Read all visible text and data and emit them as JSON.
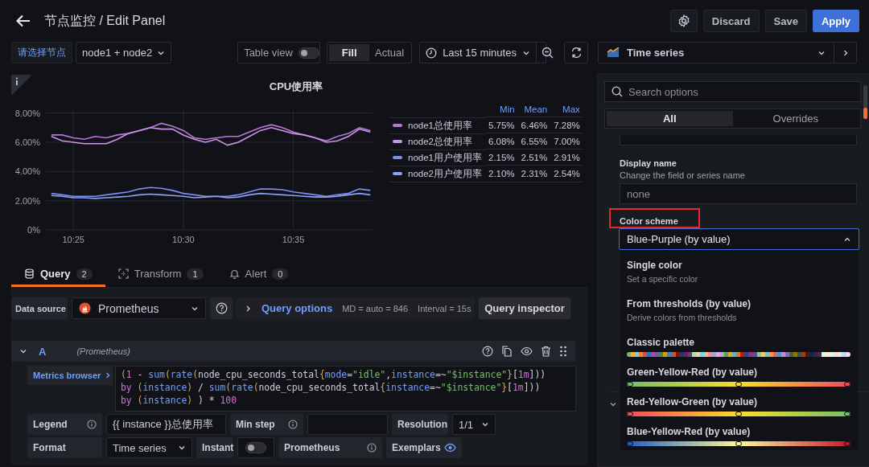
{
  "header": {
    "title": "节点监控 / Edit Panel",
    "buttons": [
      {
        "label": "Discard",
        "kind": "secondary"
      },
      {
        "label": "Save",
        "kind": "secondary"
      },
      {
        "label": "Apply",
        "kind": "primary"
      }
    ]
  },
  "toolbar": {
    "variable_label": "请选择节点",
    "variable_value": "node1 + node2",
    "table_view": {
      "label": "Table view",
      "on": false
    },
    "display_modes": [
      {
        "label": "Fill",
        "selected": true
      },
      {
        "label": "Actual",
        "selected": false
      }
    ],
    "time_range": "Last 15 minutes"
  },
  "visualization": {
    "label": "Time series"
  },
  "panel": {
    "chart_data": {
      "type": "line",
      "title": "CPU使用率",
      "grid": true,
      "categories": [
        null,
        null,
        "10:25",
        null,
        null,
        null,
        null,
        null,
        null,
        null,
        null,
        null,
        "10:30",
        null,
        null,
        null,
        null,
        null,
        null,
        null,
        null,
        null,
        "10:35",
        null,
        null,
        null,
        null,
        null,
        null,
        null
      ],
      "ylim": [
        0,
        8.2
      ],
      "yticks": [
        {
          "value": 0,
          "label": "0%"
        },
        {
          "value": 2,
          "label": "2.00%"
        },
        {
          "value": 4,
          "label": "4.00%"
        },
        {
          "value": 6,
          "label": "6.00%"
        },
        {
          "value": 8,
          "label": "8.00%"
        }
      ],
      "series": [
        {
          "name": "node1总使用率",
          "color": "#b877d9",
          "values": [
            6.5,
            6.5,
            6.3,
            6.2,
            6.4,
            6.3,
            6.5,
            6.6,
            6.8,
            7.0,
            7.3,
            7.1,
            6.8,
            6.3,
            6.2,
            6.3,
            6.4,
            6.4,
            6.7,
            7.0,
            7.2,
            7.0,
            6.7,
            6.5,
            6.3,
            6.1,
            6.4,
            6.6,
            7.0,
            6.8
          ]
        },
        {
          "name": "node2总使用率",
          "color": "#ca95e5",
          "values": [
            6.4,
            6.1,
            6.0,
            5.9,
            5.9,
            5.9,
            6.2,
            6.6,
            6.8,
            7.0,
            6.9,
            6.9,
            6.5,
            6.2,
            6.0,
            6.2,
            5.8,
            6.0,
            6.4,
            6.8,
            7.0,
            6.8,
            6.6,
            6.5,
            6.3,
            6.0,
            6.1,
            6.4,
            6.9,
            6.7
          ]
        },
        {
          "name": "node1用户使用率",
          "color": "#7c8cf2",
          "values": [
            2.5,
            2.4,
            2.3,
            2.3,
            2.3,
            2.4,
            2.5,
            2.6,
            2.8,
            2.9,
            2.85,
            2.7,
            2.5,
            2.4,
            2.3,
            2.3,
            2.3,
            2.4,
            2.6,
            2.8,
            2.8,
            2.75,
            2.6,
            2.5,
            2.4,
            2.3,
            2.4,
            2.5,
            2.8,
            2.7
          ]
        },
        {
          "name": "node2用户使用率",
          "color": "#8fa0f7",
          "values": [
            2.35,
            2.3,
            2.2,
            2.2,
            2.15,
            2.2,
            2.25,
            2.3,
            2.4,
            2.45,
            2.4,
            2.35,
            2.3,
            2.2,
            2.25,
            2.3,
            2.2,
            2.25,
            2.4,
            2.5,
            2.45,
            2.4,
            2.35,
            2.3,
            2.25,
            2.25,
            2.3,
            2.4,
            2.5,
            2.4
          ]
        }
      ]
    },
    "legend": {
      "columns": [
        "Min",
        "Mean",
        "Max"
      ],
      "rows": [
        {
          "values": [
            "5.75%",
            "6.46%",
            "7.28%"
          ]
        },
        {
          "values": [
            "6.08%",
            "6.55%",
            "7.00%"
          ]
        },
        {
          "values": [
            "2.15%",
            "2.51%",
            "2.91%"
          ]
        },
        {
          "values": [
            "2.10%",
            "2.31%",
            "2.54%"
          ]
        }
      ]
    }
  },
  "query_tabs": [
    {
      "label": "Query",
      "count": "2",
      "selected": true,
      "kind": "query"
    },
    {
      "label": "Transform",
      "count": "1",
      "selected": false,
      "kind": "transform"
    },
    {
      "label": "Alert",
      "count": "0",
      "selected": false,
      "kind": "alert"
    }
  ],
  "query_bar": {
    "data_source_label": "Data source",
    "data_source": "Prometheus",
    "options_label": "Query options",
    "md": "MD = auto = 846",
    "interval": "Interval = 15s",
    "inspector": "Query inspector"
  },
  "query": {
    "ref": "A",
    "source": "(Prometheus)",
    "metrics_browser": "Metrics browser",
    "code_lines": [
      [
        {
          "t": "(",
          "kind": "punct"
        },
        {
          "t": "1",
          "kind": "number"
        },
        {
          "t": " - ",
          "kind": "plain"
        },
        {
          "t": "sum",
          "kind": "func"
        },
        {
          "t": "(",
          "kind": "punct"
        },
        {
          "t": "rate",
          "kind": "func"
        },
        {
          "t": "(",
          "kind": "punct"
        },
        {
          "t": "node_cpu_seconds_total",
          "kind": "plain"
        },
        {
          "t": "{",
          "kind": "punct"
        },
        {
          "t": "mode",
          "kind": "label"
        },
        {
          "t": "=",
          "kind": "plain"
        },
        {
          "t": "\"idle\"",
          "kind": "string"
        },
        {
          "t": ",",
          "kind": "plain"
        },
        {
          "t": "instance",
          "kind": "label"
        },
        {
          "t": "=~",
          "kind": "plain"
        },
        {
          "t": "\"$instance\"",
          "kind": "string"
        },
        {
          "t": "}",
          "kind": "punct"
        },
        {
          "t": "[",
          "kind": "plain"
        },
        {
          "t": "1m",
          "kind": "number"
        },
        {
          "t": "]))",
          "kind": "plain"
        }
      ],
      [
        {
          "t": "by ",
          "kind": "keyword"
        },
        {
          "t": "(",
          "kind": "punct"
        },
        {
          "t": "instance",
          "kind": "label"
        },
        {
          "t": ")",
          "kind": "punct"
        },
        {
          "t": " / ",
          "kind": "plain"
        },
        {
          "t": "sum",
          "kind": "func"
        },
        {
          "t": "(",
          "kind": "punct"
        },
        {
          "t": "rate",
          "kind": "func"
        },
        {
          "t": "(",
          "kind": "punct"
        },
        {
          "t": "node_cpu_seconds_total",
          "kind": "plain"
        },
        {
          "t": "{",
          "kind": "punct"
        },
        {
          "t": "instance",
          "kind": "label"
        },
        {
          "t": "=~",
          "kind": "plain"
        },
        {
          "t": "\"$instance\"",
          "kind": "string"
        },
        {
          "t": "}",
          "kind": "punct"
        },
        {
          "t": "[",
          "kind": "plain"
        },
        {
          "t": "1m",
          "kind": "number"
        },
        {
          "t": "]))",
          "kind": "plain"
        }
      ],
      [
        {
          "t": "by ",
          "kind": "keyword"
        },
        {
          "t": "(",
          "kind": "punct"
        },
        {
          "t": "instance",
          "kind": "label"
        },
        {
          "t": ")",
          "kind": "punct"
        },
        {
          "t": " ) * ",
          "kind": "plain"
        },
        {
          "t": "100",
          "kind": "number"
        }
      ]
    ],
    "legend_label": "Legend",
    "legend_value": "{{  instance }}总使用率",
    "min_step_label": "Min step",
    "resolution_label": "Resolution",
    "resolution": "1/1",
    "format_label": "Format",
    "format": "Time series",
    "instant_label": "Instant",
    "instant_on": false,
    "type_label": "Prometheus",
    "exemplars_label": "Exemplars"
  },
  "options": {
    "search_placeholder": "Search options",
    "tabs": [
      {
        "label": "All",
        "selected": true
      },
      {
        "label": "Overrides",
        "selected": false
      }
    ],
    "display_name": {
      "label": "Display name",
      "description": "Change the field or series name",
      "placeholder": "none"
    },
    "color_scheme": {
      "label": "Color scheme",
      "highlighted": true,
      "value": "Blue-Purple (by value)",
      "expanded": true,
      "options": [
        {
          "label": "Single color",
          "description": "Set a specific color",
          "kind": "text"
        },
        {
          "label": "From thresholds (by value)",
          "description": "Derive colors from thresholds",
          "kind": "text"
        },
        {
          "label": "Classic palette",
          "kind": "palette",
          "swatches": [
            {
              "color": "#7eb26d"
            },
            {
              "color": "#eab839"
            },
            {
              "color": "#6ed0e0"
            },
            {
              "color": "#ef843c"
            },
            {
              "color": "#e24d42"
            },
            {
              "color": "#1f78c1"
            },
            {
              "color": "#ba43a9"
            },
            {
              "color": "#705da0"
            },
            {
              "color": "#508642"
            },
            {
              "color": "#cca300"
            },
            {
              "color": "#447ebc"
            },
            {
              "color": "#c15c17"
            },
            {
              "color": "#890f02"
            },
            {
              "color": "#0a437c"
            },
            {
              "color": "#6d1f62"
            },
            {
              "color": "#584477"
            },
            {
              "color": "#b7dbab"
            },
            {
              "color": "#f4d598"
            },
            {
              "color": "#70dbed"
            },
            {
              "color": "#f9ba8f"
            },
            {
              "color": "#f29191"
            },
            {
              "color": "#82b5d8"
            },
            {
              "color": "#e5a8e2"
            },
            {
              "color": "#aea2e0"
            },
            {
              "color": "#629e51"
            },
            {
              "color": "#e5ac0e"
            },
            {
              "color": "#64b0c8"
            },
            {
              "color": "#e0752d"
            },
            {
              "color": "#bf1b00"
            },
            {
              "color": "#0a50a1"
            },
            {
              "color": "#962d82"
            },
            {
              "color": "#614d93"
            },
            {
              "color": "#9ac48a"
            },
            {
              "color": "#f2c96d"
            },
            {
              "color": "#65c5db"
            },
            {
              "color": "#f9934e"
            },
            {
              "color": "#ea6460"
            },
            {
              "color": "#5195ce"
            },
            {
              "color": "#d683ce"
            },
            {
              "color": "#806eb7"
            },
            {
              "color": "#3f6833"
            },
            {
              "color": "#967302"
            },
            {
              "color": "#2f575e"
            },
            {
              "color": "#99440a"
            },
            {
              "color": "#58140c"
            },
            {
              "color": "#052b51"
            },
            {
              "color": "#511749"
            },
            {
              "color": "#3f2b5b"
            },
            {
              "color": "#e0f9d7"
            },
            {
              "color": "#fceacc"
            },
            {
              "color": "#cffaff"
            },
            {
              "color": "#f9e2d2"
            },
            {
              "color": "#fce2de"
            },
            {
              "color": "#badff4"
            },
            {
              "color": "#f9d9f9"
            }
          ]
        },
        {
          "label": "Green-Yellow-Red (by value)",
          "kind": "gradient",
          "stops": [
            {
              "color": "#73bf69"
            },
            {
              "color": "#fade2a"
            },
            {
              "color": "#f2495c"
            }
          ]
        },
        {
          "label": "Red-Yellow-Green (by value)",
          "kind": "gradient",
          "stops": [
            {
              "color": "#f2495c"
            },
            {
              "color": "#fade2a"
            },
            {
              "color": "#73bf69"
            }
          ]
        },
        {
          "label": "Blue-Yellow-Red (by value)",
          "kind": "gradient",
          "stops": [
            {
              "color": "#1f60c4"
            },
            {
              "color": "#fff899"
            },
            {
              "color": "#c4162a"
            }
          ]
        }
      ]
    }
  }
}
